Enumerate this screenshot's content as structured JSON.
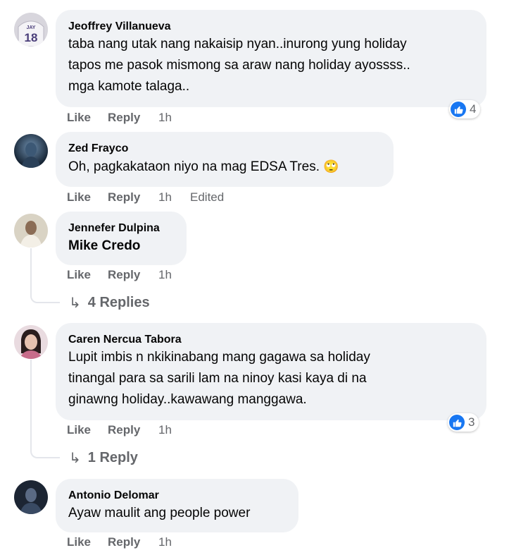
{
  "comments": [
    {
      "author": "Jeoffrey Villanueva",
      "lines": [
        "taba nang utak nang nakaisip nyan..inurong yung holiday",
        "tapos me pasok mismong sa araw nang holiday ayossss..",
        "mga kamote talaga.."
      ],
      "like": "Like",
      "reply": "Reply",
      "time": "1h",
      "reaction_count": "4"
    },
    {
      "author": "Zed Frayco",
      "text": "Oh, pagkakataon niyo na mag EDSA Tres.",
      "emoji": "🙄",
      "like": "Like",
      "reply": "Reply",
      "time": "1h",
      "edited": "Edited"
    },
    {
      "author": "Jennefer Dulpina",
      "text": "Mike Credo",
      "like": "Like",
      "reply": "Reply",
      "time": "1h",
      "replies": "4 Replies"
    },
    {
      "author": "Caren Nercua Tabora",
      "lines": [
        "Lupit imbis n nkikinabang mang gagawa sa holiday",
        "tinangal para sa sarili lam na ninoy kasi kaya di na",
        "ginawng holiday..kawawang manggawa."
      ],
      "like": "Like",
      "reply": "Reply",
      "time": "1h",
      "reaction_count": "3",
      "replies": "1 Reply"
    },
    {
      "author": "Antonio Delomar",
      "text": "Ayaw maulit ang people power",
      "like": "Like",
      "reply": "Reply",
      "time": "1h"
    }
  ],
  "avatar_jersey_text": "18",
  "avatar_jersey_name": "JAY",
  "colors": {
    "bubble": "#f0f2f5",
    "meta": "#65676b",
    "like_blue": "#1877f2"
  }
}
